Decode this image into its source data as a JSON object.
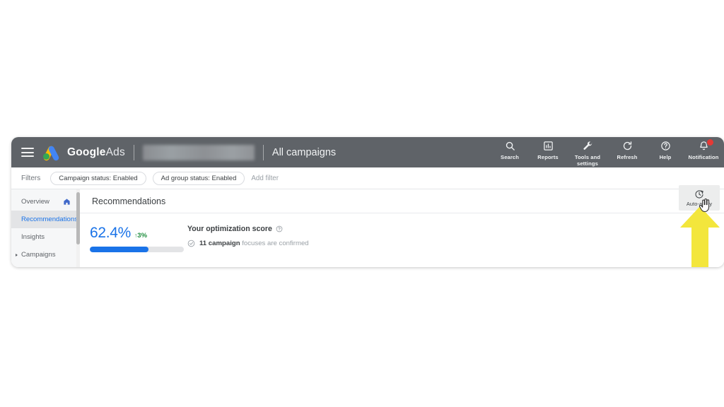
{
  "app": {
    "brand_bold": "Google",
    "brand_light": "Ads",
    "account_redacted": "",
    "page_scope": "All campaigns",
    "menu_icon": "hamburger-icon",
    "logo_icon": "google-ads-logo"
  },
  "topbar_actions": [
    {
      "label": "Search",
      "icon": "search-icon"
    },
    {
      "label": "Reports",
      "icon": "bar-chart-icon"
    },
    {
      "label": "Tools and settings",
      "icon": "wrench-icon"
    },
    {
      "label": "Refresh",
      "icon": "refresh-icon"
    },
    {
      "label": "Help",
      "icon": "help-circle-icon"
    },
    {
      "label": "Notification",
      "icon": "bell-icon",
      "badge": true
    }
  ],
  "filters": {
    "label": "Filters",
    "chips": [
      "Campaign status: Enabled",
      "Ad group status: Enabled"
    ],
    "add_filter": "Add filter"
  },
  "sidebar": {
    "items": [
      {
        "label": "Overview",
        "icon": "home-icon",
        "active": false,
        "expandable": false
      },
      {
        "label": "Recommendations",
        "icon": "",
        "active": true,
        "expandable": false
      },
      {
        "label": "Insights",
        "icon": "",
        "active": false,
        "expandable": false
      },
      {
        "label": "Campaigns",
        "icon": "",
        "active": false,
        "expandable": true
      }
    ]
  },
  "content": {
    "title": "Recommendations",
    "auto_apply": {
      "label": "Auto-apply",
      "icon": "clock-auto-apply-icon"
    },
    "score": {
      "value": "62.4%",
      "delta": "3%",
      "delta_arrow": "↑",
      "progress_percent": 62.4
    },
    "optimization": {
      "title": "Your optimization score",
      "help_icon": "help-circle-icon",
      "status_icon": "check-circle-icon",
      "status_strong": "11 campaign",
      "status_rest": " focuses are confirmed"
    }
  },
  "annotation": {
    "arrow_icon": "up-arrow-annotation",
    "arrow_color": "#F3E63C",
    "cursor_icon": "hand-cursor-icon"
  },
  "colors": {
    "topbar_bg": "#5f6368",
    "accent_blue": "#1a73e8",
    "positive_green": "#1e8e3e",
    "badge_red": "#e53935",
    "sidebar_bg": "#f6f7f8",
    "sidebar_active_bg": "#e3e4e6"
  }
}
